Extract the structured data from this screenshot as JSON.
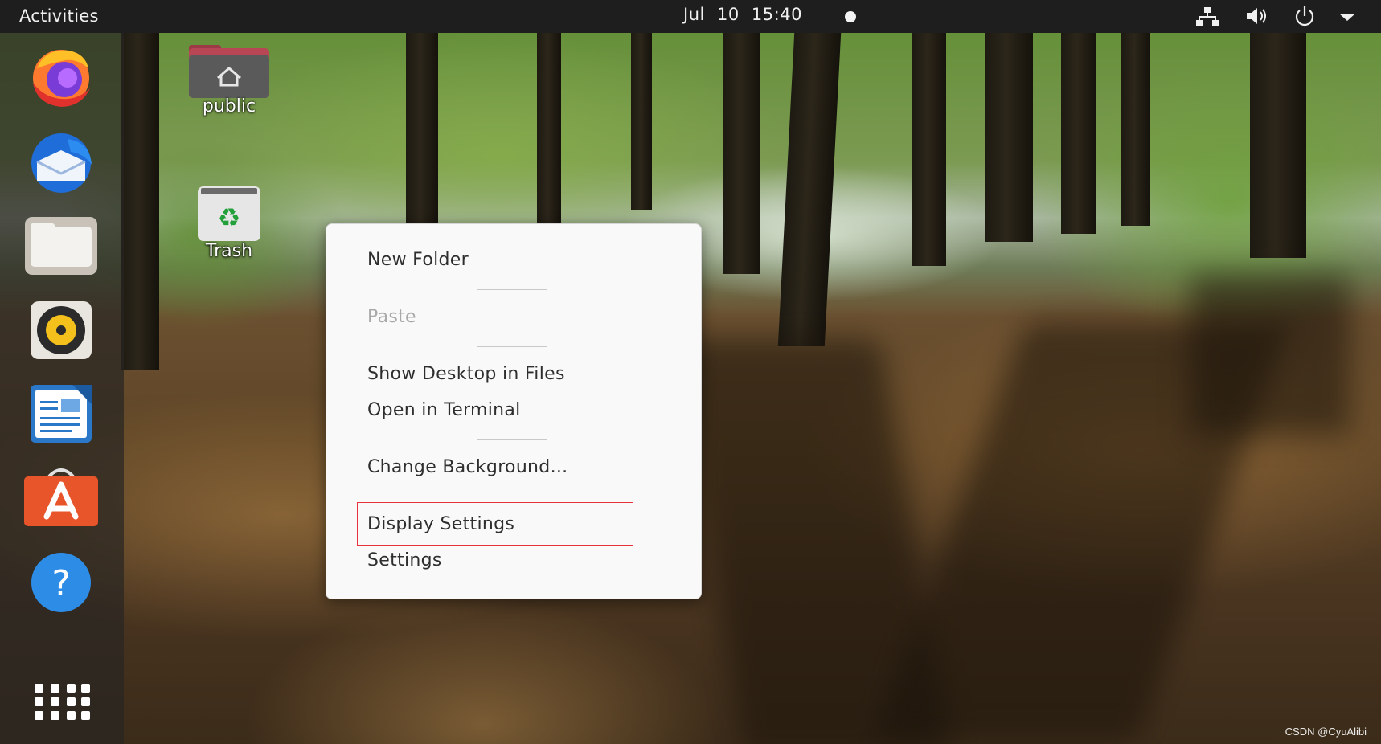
{
  "topbar": {
    "activities": "Activities",
    "clock": "Jul 10  15:40",
    "tray_icons": [
      "network-icon",
      "volume-icon",
      "power-icon",
      "menu-arrow-icon"
    ]
  },
  "dock": {
    "apps": [
      "firefox-icon",
      "thunderbird-icon",
      "files-icon",
      "rhythmbox-icon",
      "writer-icon",
      "software-center-icon",
      "help-icon"
    ],
    "show_apps": "apps-grid-icon"
  },
  "desktop": {
    "icons": [
      {
        "label": "public",
        "icon": "home-folder-icon"
      },
      {
        "label": "Trash",
        "icon": "trash-icon"
      }
    ]
  },
  "context_menu": {
    "items": [
      {
        "label": "New Folder"
      },
      {
        "label": "Paste",
        "disabled": true
      },
      {
        "label": "Show Desktop in Files"
      },
      {
        "label": "Open in Terminal"
      },
      {
        "label": "Change Background..."
      },
      {
        "label": "Display Settings",
        "highlighted": true
      },
      {
        "label": "Settings"
      }
    ],
    "highlight_color": "#e8333a"
  },
  "watermark": "CSDN @CyuAlibi",
  "colors": {
    "topbar_bg": "#1e1e1e",
    "menu_bg": "#f9f9f9",
    "menu_text": "#2e2e2e",
    "menu_disabled_text": "#a8a8a8"
  }
}
